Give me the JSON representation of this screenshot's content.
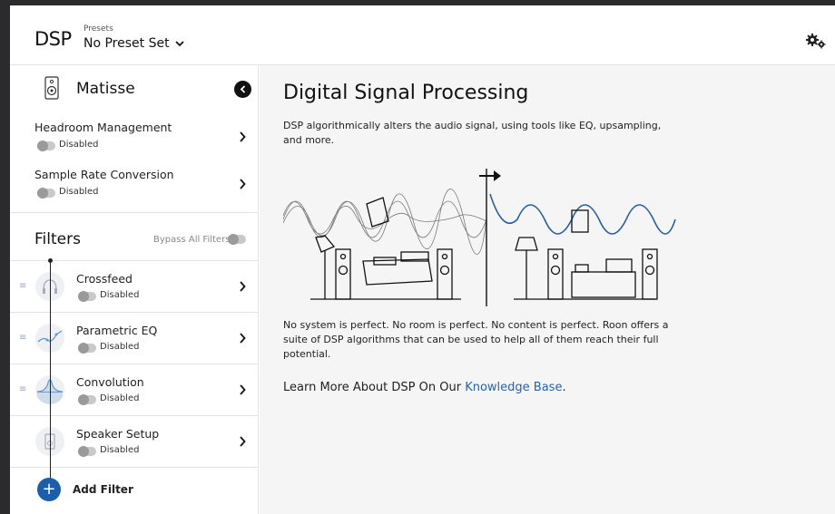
{
  "header": {
    "title": "DSP",
    "presets_label": "Presets",
    "preset_value": "No Preset Set"
  },
  "sidebar": {
    "zone_name": "Matisse",
    "settings": [
      {
        "title": "Headroom Management",
        "status": "Disabled"
      },
      {
        "title": "Sample Rate Conversion",
        "status": "Disabled"
      }
    ],
    "filters_title": "Filters",
    "bypass_label": "Bypass All Filters",
    "filters": [
      {
        "name": "Crossfeed",
        "status": "Disabled"
      },
      {
        "name": "Parametric EQ",
        "status": "Disabled"
      },
      {
        "name": "Convolution",
        "status": "Disabled"
      },
      {
        "name": "Speaker Setup",
        "status": "Disabled"
      }
    ],
    "add_filter_label": "Add Filter"
  },
  "main": {
    "title": "Digital Signal Processing",
    "intro": "DSP algorithmically alters the audio signal, using tools like EQ, upsampling, and more.",
    "body": "No system is perfect. No room is perfect. No content is perfect. Roon offers a suite of DSP algorithms that can be used to help all of them reach their full potential.",
    "learn_prefix": "Learn More About DSP On Our",
    "learn_link": "Knowledge Base",
    "learn_suffix": "."
  },
  "colors": {
    "accent": "#1a5eac",
    "link": "#2164b3",
    "wave_processed": "#2a5fa8"
  }
}
